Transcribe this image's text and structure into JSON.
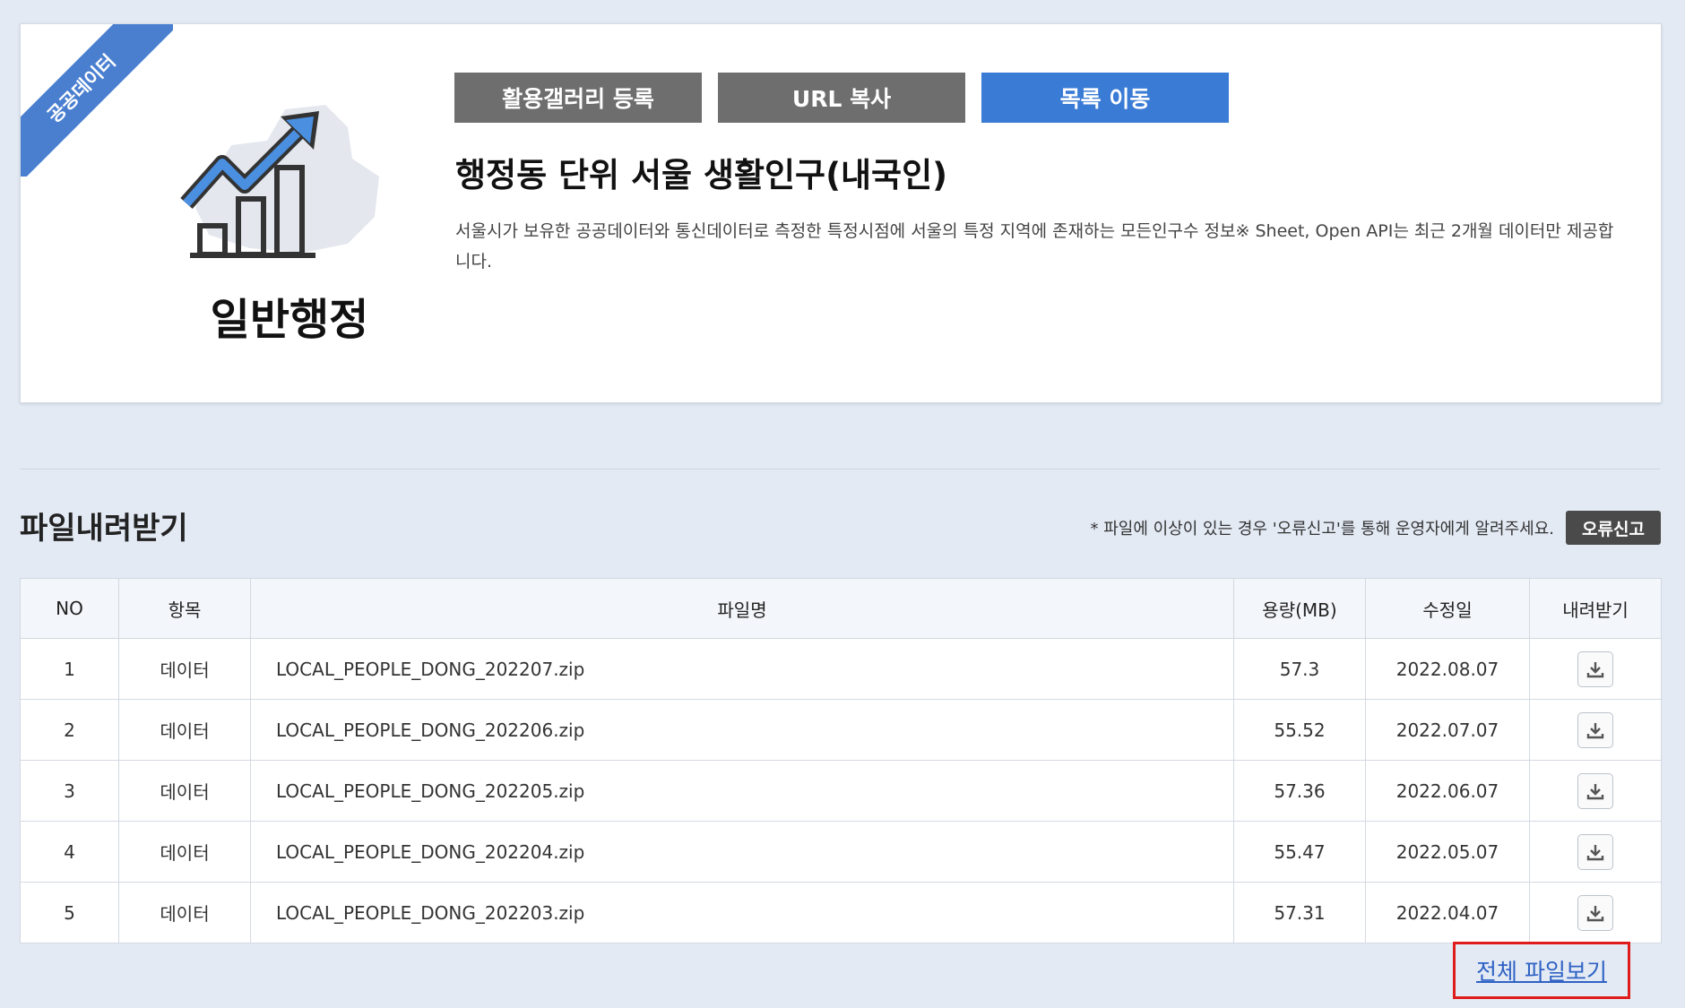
{
  "card": {
    "ribbon": "공공데이터",
    "category": "일반행정",
    "buttons": {
      "gallery": "활용갤러리 등록",
      "url_copy": "URL 복사",
      "list": "목록 이동"
    },
    "title": "행정동 단위 서울 생활인구(내국인)",
    "description": "서울시가 보유한 공공데이터와 통신데이터로 측정한 특정시점에 서울의 특정 지역에 존재하는 모든인구수 정보※ Sheet, Open API는 최근 2개월 데이터만 제공합니다."
  },
  "download": {
    "section_title": "파일내려받기",
    "notice": "* 파일에 이상이 있는 경우 '오류신고'를 통해 운영자에게 알려주세요.",
    "report_label": "오류신고",
    "columns": [
      "NO",
      "항목",
      "파일명",
      "용량(MB)",
      "수정일",
      "내려받기"
    ],
    "rows": [
      {
        "no": "1",
        "type": "데이터",
        "filename": "LOCAL_PEOPLE_DONG_202207.zip",
        "size": "57.3",
        "date": "2022.08.07"
      },
      {
        "no": "2",
        "type": "데이터",
        "filename": "LOCAL_PEOPLE_DONG_202206.zip",
        "size": "55.52",
        "date": "2022.07.07"
      },
      {
        "no": "3",
        "type": "데이터",
        "filename": "LOCAL_PEOPLE_DONG_202205.zip",
        "size": "57.36",
        "date": "2022.06.07"
      },
      {
        "no": "4",
        "type": "데이터",
        "filename": "LOCAL_PEOPLE_DONG_202204.zip",
        "size": "55.47",
        "date": "2022.05.07"
      },
      {
        "no": "5",
        "type": "데이터",
        "filename": "LOCAL_PEOPLE_DONG_202203.zip",
        "size": "57.31",
        "date": "2022.04.07"
      }
    ],
    "view_all": "전체 파일보기"
  },
  "colors": {
    "accent_blue": "#3a7bd5",
    "ribbon_blue": "#4a7fd0",
    "gray_button": "#6e6e6e",
    "highlight_red": "#e01b1b",
    "link_blue": "#2f62c4"
  },
  "icons": {
    "category": "chart-growth-icon",
    "download": "download-icon"
  }
}
